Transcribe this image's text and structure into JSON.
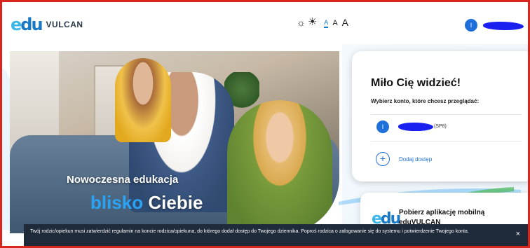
{
  "header": {
    "logo_mark_e": "e",
    "logo_mark_du": "du",
    "logo_text": "VULCAN",
    "contrast_icon_1": "☼",
    "contrast_icon_2": "☀",
    "font_small": "A",
    "font_medium": "A",
    "font_large": "A",
    "user_initial": "I"
  },
  "hero": {
    "title": "Nowoczesna edukacja",
    "subtitle_blue": "blisko",
    "subtitle_white": "Ciebie"
  },
  "welcome_card": {
    "title": "Miło Cię widzieć!",
    "subtitle": "Wybierz konto, które chcesz przeglądać:",
    "account_initial": "I",
    "account_tag": "(SP8)",
    "add_icon": "+",
    "add_label": "Dodaj dostęp"
  },
  "app_card": {
    "logo_e": "e",
    "logo_du": "du",
    "text": "Pobierz aplikację mobilną eduVULCAN"
  },
  "notice": {
    "text": "Twój rodzic/opiekun musi zatwierdzić regulamin na koncie rodzica/opiekuna, do którego dodał dostęp do Twojego dziennika. Poproś rodzica o zalogowanie się do systemu i potwierdzenie Twojego konta.",
    "close_icon": "×"
  },
  "colors": {
    "brand_blue": "#1a79c7",
    "accent_blue": "#2aa3f4",
    "frame_red": "#d7261e",
    "notice_bg": "#1f2a3a"
  }
}
